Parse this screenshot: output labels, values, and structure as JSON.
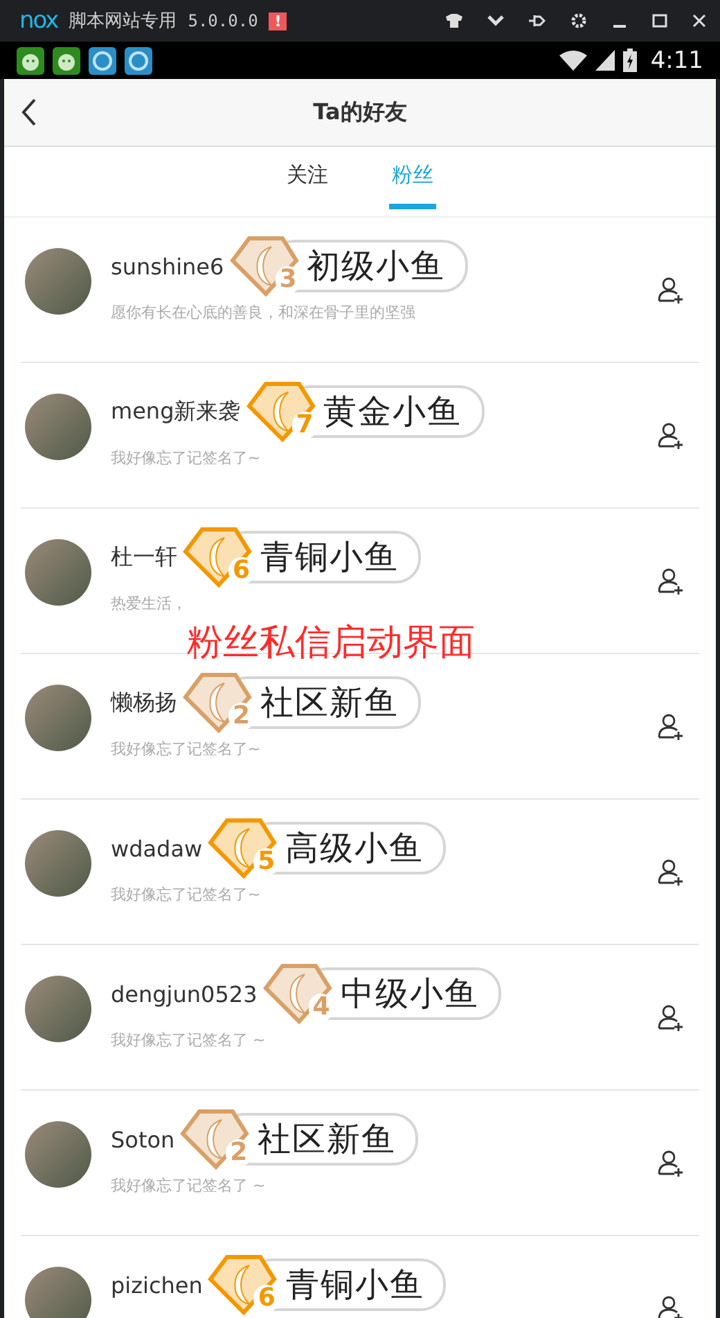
{
  "emulator_bar": {
    "logo": "nox",
    "title": "脚本网站专用",
    "version": "5.0.0.0",
    "alert": "!"
  },
  "status_bar": {
    "time": "4:11"
  },
  "header": {
    "title": "Ta的好友"
  },
  "tabs": [
    {
      "label": "关注",
      "selected": false
    },
    {
      "label": "粉丝",
      "selected": true
    }
  ],
  "fans": [
    {
      "name": "sunshine6",
      "level": "3",
      "rank": "初级小鱼",
      "color": "#d9a066",
      "signature": "愿你有长在心底的善良，和深在骨子里的坚强"
    },
    {
      "name": "meng新来袭",
      "level": "7",
      "rank": "黄金小鱼",
      "color": "#f39800",
      "signature": "我好像忘了记签名了~"
    },
    {
      "name": "杜一轩",
      "level": "6",
      "rank": "青铜小鱼",
      "color": "#f39800",
      "signature": "热爱生活，"
    },
    {
      "name": "懒杨扬",
      "level": "2",
      "rank": "社区新鱼",
      "color": "#d9a066",
      "signature": "我好像忘了记签名了~"
    },
    {
      "name": "wdadaw",
      "level": "5",
      "rank": "高级小鱼",
      "color": "#f39800",
      "signature": "我好像忘了记签名了~"
    },
    {
      "name": "dengjun0523",
      "level": "4",
      "rank": "中级小鱼",
      "color": "#d9a066",
      "signature": "我好像忘了记签名了 ~"
    },
    {
      "name": "Soton",
      "level": "2",
      "rank": "社区新鱼",
      "color": "#d9a066",
      "signature": "我好像忘了记签名了 ~"
    },
    {
      "name": "pizichen",
      "level": "6",
      "rank": "青铜小鱼",
      "color": "#f39800"
    }
  ],
  "overlay_caption": "粉丝私信启动界面"
}
